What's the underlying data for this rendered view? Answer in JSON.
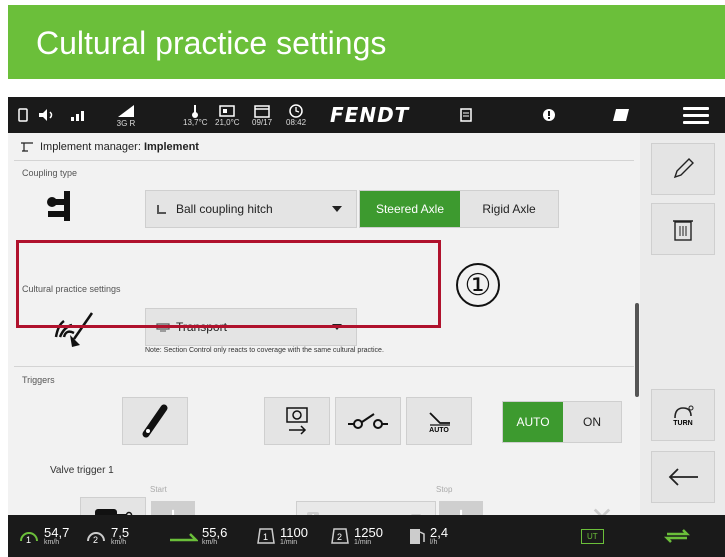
{
  "banner": {
    "title": "Cultural practice settings"
  },
  "statusbar": {
    "signal_sub": "3G R",
    "temp_outside": "13,7°C",
    "temp_cab": "21,0°C",
    "date": "09/17",
    "time": "08:42",
    "brand": "FENDT"
  },
  "header": {
    "prefix": "Implement manager: ",
    "name": "Implement"
  },
  "coupling": {
    "label": "Coupling type",
    "hitch": "Ball coupling hitch",
    "options": [
      "Steered Axle",
      "Rigid Axle"
    ],
    "selected": "Steered Axle"
  },
  "cultural": {
    "label": "Cultural practice settings",
    "value": "Transport",
    "note": "Note: Section Control only reacts to coverage with the same cultural practice.",
    "callout": "①"
  },
  "triggers": {
    "label": "Triggers",
    "auto_toggle": [
      "AUTO",
      "ON"
    ],
    "auto_icon_label": "AUTO",
    "valve_label": "Valve trigger 1",
    "start_label": "Start",
    "stop_label": "Stop",
    "valve_num": "1"
  },
  "right_panel": {
    "turn_label": "TURN"
  },
  "bottombar": {
    "speed1": "54,7",
    "speed1_unit": "km/h",
    "speed2": "7,5",
    "speed2_unit": "km/h",
    "speed3": "55,6",
    "speed3_unit": "km/h",
    "rpm1": "1100",
    "rpm1_unit": "1/min",
    "rpm2": "1250",
    "rpm2_unit": "1/min",
    "fuel": "2,4",
    "fuel_unit": "l/h",
    "ut": "UT"
  },
  "colors": {
    "accent_green": "#3d9a2f",
    "banner_green": "#6bbf3a",
    "highlight_red": "#b0122d"
  }
}
